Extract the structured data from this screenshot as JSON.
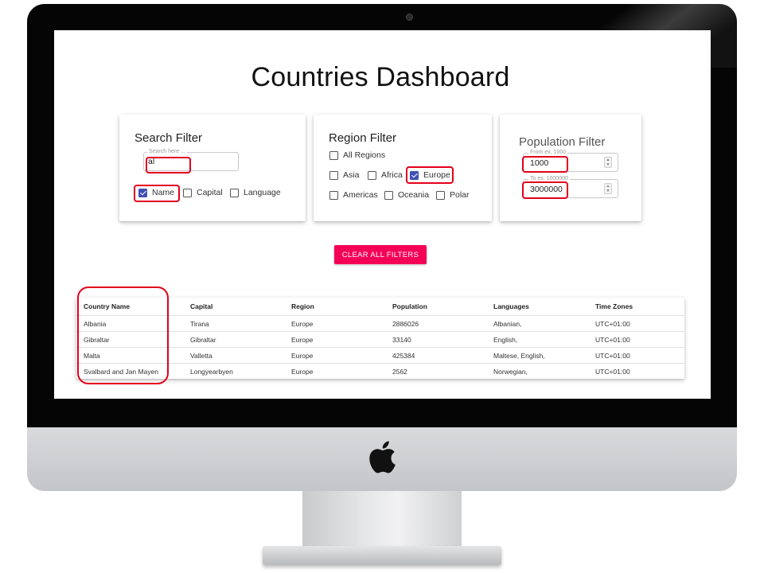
{
  "page": {
    "title": "Countries Dashboard",
    "clear_button": "CLEAR ALL FILTERS"
  },
  "search_filter": {
    "title": "Search Filter",
    "input_label": "Search here ...",
    "input_value": "al",
    "options": [
      {
        "label": "Name",
        "checked": true
      },
      {
        "label": "Capital",
        "checked": false
      },
      {
        "label": "Language",
        "checked": false
      }
    ]
  },
  "region_filter": {
    "title": "Region Filter",
    "options": [
      {
        "label": "All Regions",
        "checked": false
      },
      {
        "label": "Asia",
        "checked": false
      },
      {
        "label": "Africa",
        "checked": false
      },
      {
        "label": "Europe",
        "checked": true
      },
      {
        "label": "Americas",
        "checked": false
      },
      {
        "label": "Oceania",
        "checked": false
      },
      {
        "label": "Polar",
        "checked": false
      }
    ]
  },
  "population_filter": {
    "title": "Population Filter",
    "from_label": "From ex. 1000",
    "from_value": "1000",
    "to_label": "To ex. 1000000",
    "to_value": "3000000"
  },
  "table": {
    "headers": [
      "Country Name",
      "Capital",
      "Region",
      "Population",
      "Languages",
      "Time Zones"
    ],
    "rows": [
      [
        "Albania",
        "Tirana",
        "Europe",
        "2886026",
        "Albanian,",
        "UTC+01:00"
      ],
      [
        "Gibraltar",
        "Gibraltar",
        "Europe",
        "33140",
        "English,",
        "UTC+01:00"
      ],
      [
        "Malta",
        "Valletta",
        "Europe",
        "425384",
        "Maltese, English,",
        "UTC+01:00"
      ],
      [
        "Svalbard and Jan Mayen",
        "Longyearbyen",
        "Europe",
        "2562",
        "Norwegian,",
        "UTC+01:00"
      ]
    ]
  },
  "colors": {
    "accent": "#f50057",
    "checkbox": "#3f51b5",
    "highlight": "#e3001b"
  }
}
